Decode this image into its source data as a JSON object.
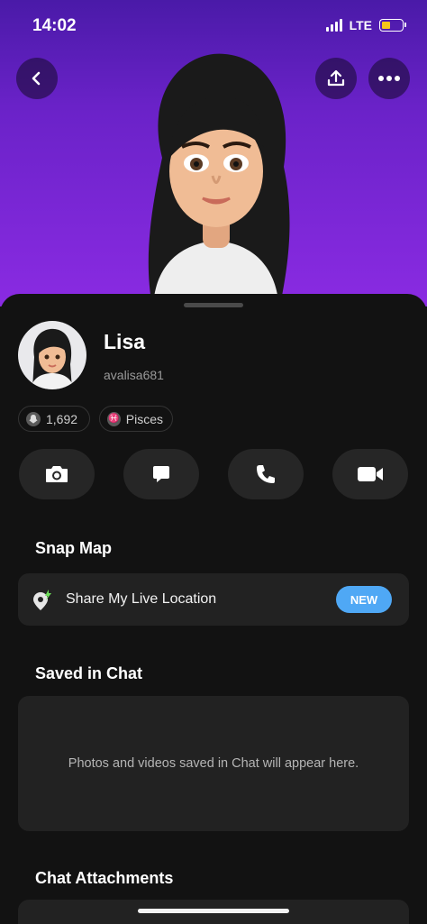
{
  "status_bar": {
    "time": "14:02",
    "network": "LTE",
    "battery_color": "#f5c518"
  },
  "header": {
    "back_icon": "chevron-left-icon",
    "share_icon": "upload-icon",
    "more_icon": "ellipsis-icon"
  },
  "profile": {
    "name": "Lisa",
    "username": "avalisa681",
    "snap_score": "1,692",
    "zodiac": "Pisces"
  },
  "actions": [
    {
      "icon": "camera-icon"
    },
    {
      "icon": "chat-icon"
    },
    {
      "icon": "phone-icon"
    },
    {
      "icon": "video-icon"
    }
  ],
  "snap_map": {
    "title": "Snap Map",
    "share_label": "Share My Live Location",
    "badge": "NEW",
    "badge_color": "#4fa8f5"
  },
  "saved_in_chat": {
    "title": "Saved in Chat",
    "empty_text": "Photos and videos saved in Chat will appear here."
  },
  "chat_attachments": {
    "title": "Chat Attachments"
  },
  "colors": {
    "hero_gradient_top": "#4a1aa8",
    "hero_gradient_bottom": "#8a2be2",
    "sheet_bg": "#121212",
    "card_bg": "#222222"
  }
}
